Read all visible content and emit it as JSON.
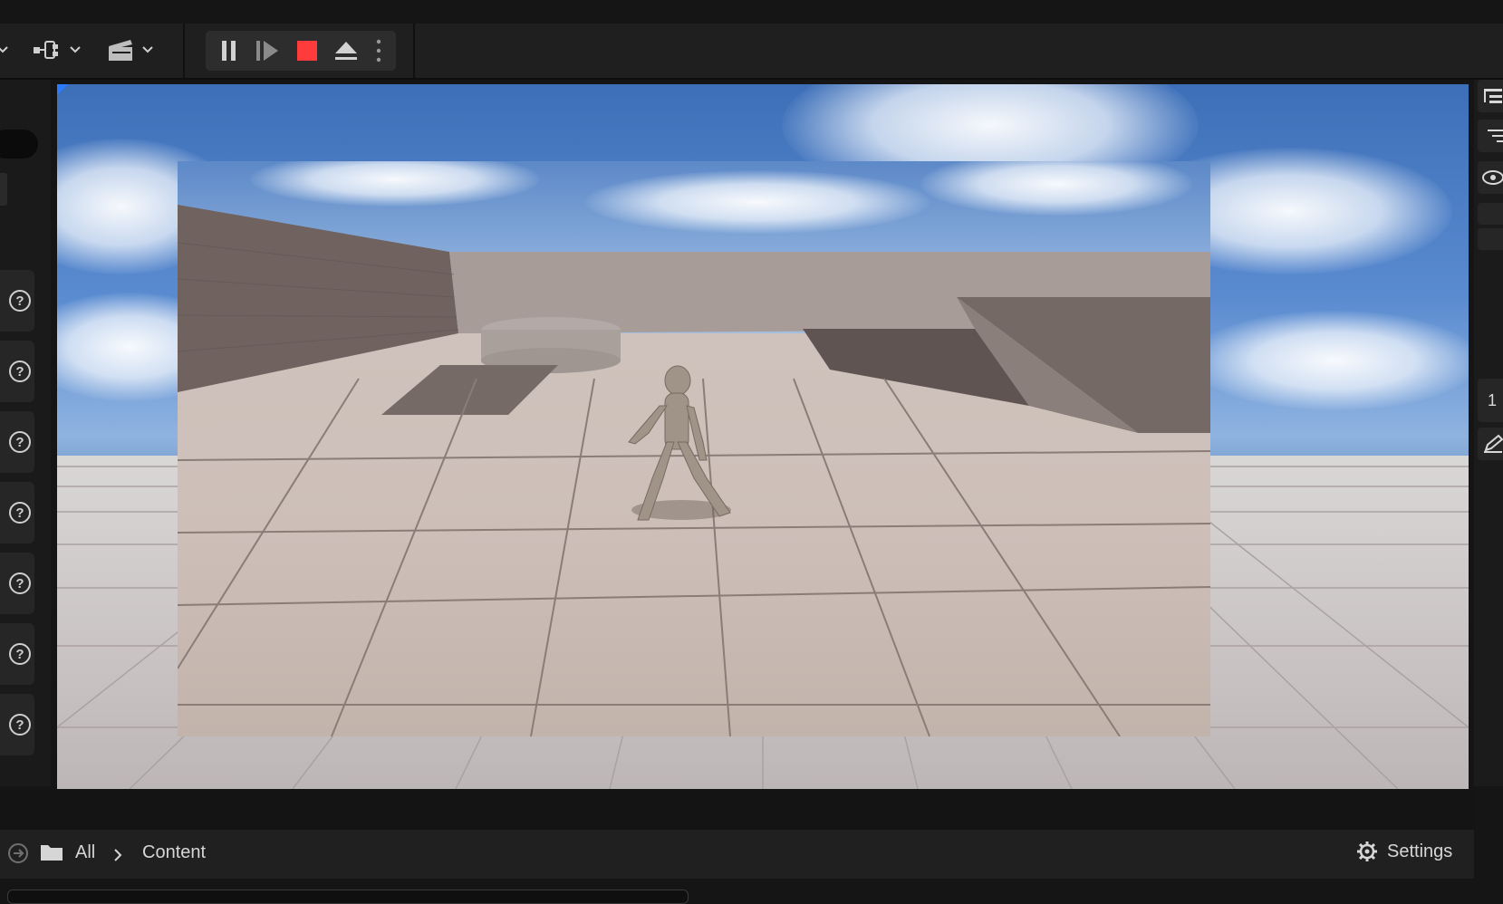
{
  "toolbar": {
    "icons": [
      "chevron-down-icon",
      "blueprint-icon",
      "cinematics-icon",
      "pause-icon",
      "step-icon",
      "stop-icon",
      "eject-icon",
      "more-icon"
    ],
    "colors": {
      "stop": "#ff3b3b",
      "accent": "#2a7bff"
    }
  },
  "left_panel": {
    "help_items": [
      "?",
      "?",
      "?",
      "?",
      "?",
      "?",
      "?"
    ]
  },
  "right_panel": {
    "partial_label": "1"
  },
  "content_browser": {
    "breadcrumb": [
      "All",
      "Content"
    ],
    "settings_label": "Settings"
  }
}
